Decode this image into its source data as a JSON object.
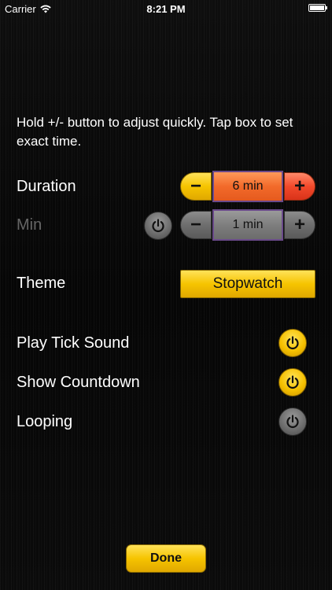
{
  "status_bar": {
    "carrier": "Carrier",
    "time": "8:21 PM"
  },
  "instructions": "Hold +/- button to adjust quickly. Tap box to set exact time.",
  "duration": {
    "label": "Duration",
    "value": "6 min",
    "minus": "−",
    "plus": "+"
  },
  "min": {
    "label": "Min",
    "value": "1 min",
    "minus": "−",
    "plus": "+",
    "enabled": false
  },
  "theme": {
    "label": "Theme",
    "value": "Stopwatch"
  },
  "toggles": [
    {
      "label": "Play Tick Sound",
      "on": true
    },
    {
      "label": "Show Countdown",
      "on": true
    },
    {
      "label": "Looping",
      "on": false
    }
  ],
  "done_label": "Done",
  "colors": {
    "accent_yellow": "#f6c400",
    "duration_red": "#f2492a",
    "disabled_grey": "#6e6e6e",
    "dim_label": "#666666"
  },
  "icons": [
    "wifi-icon",
    "battery-icon",
    "power-icon"
  ]
}
